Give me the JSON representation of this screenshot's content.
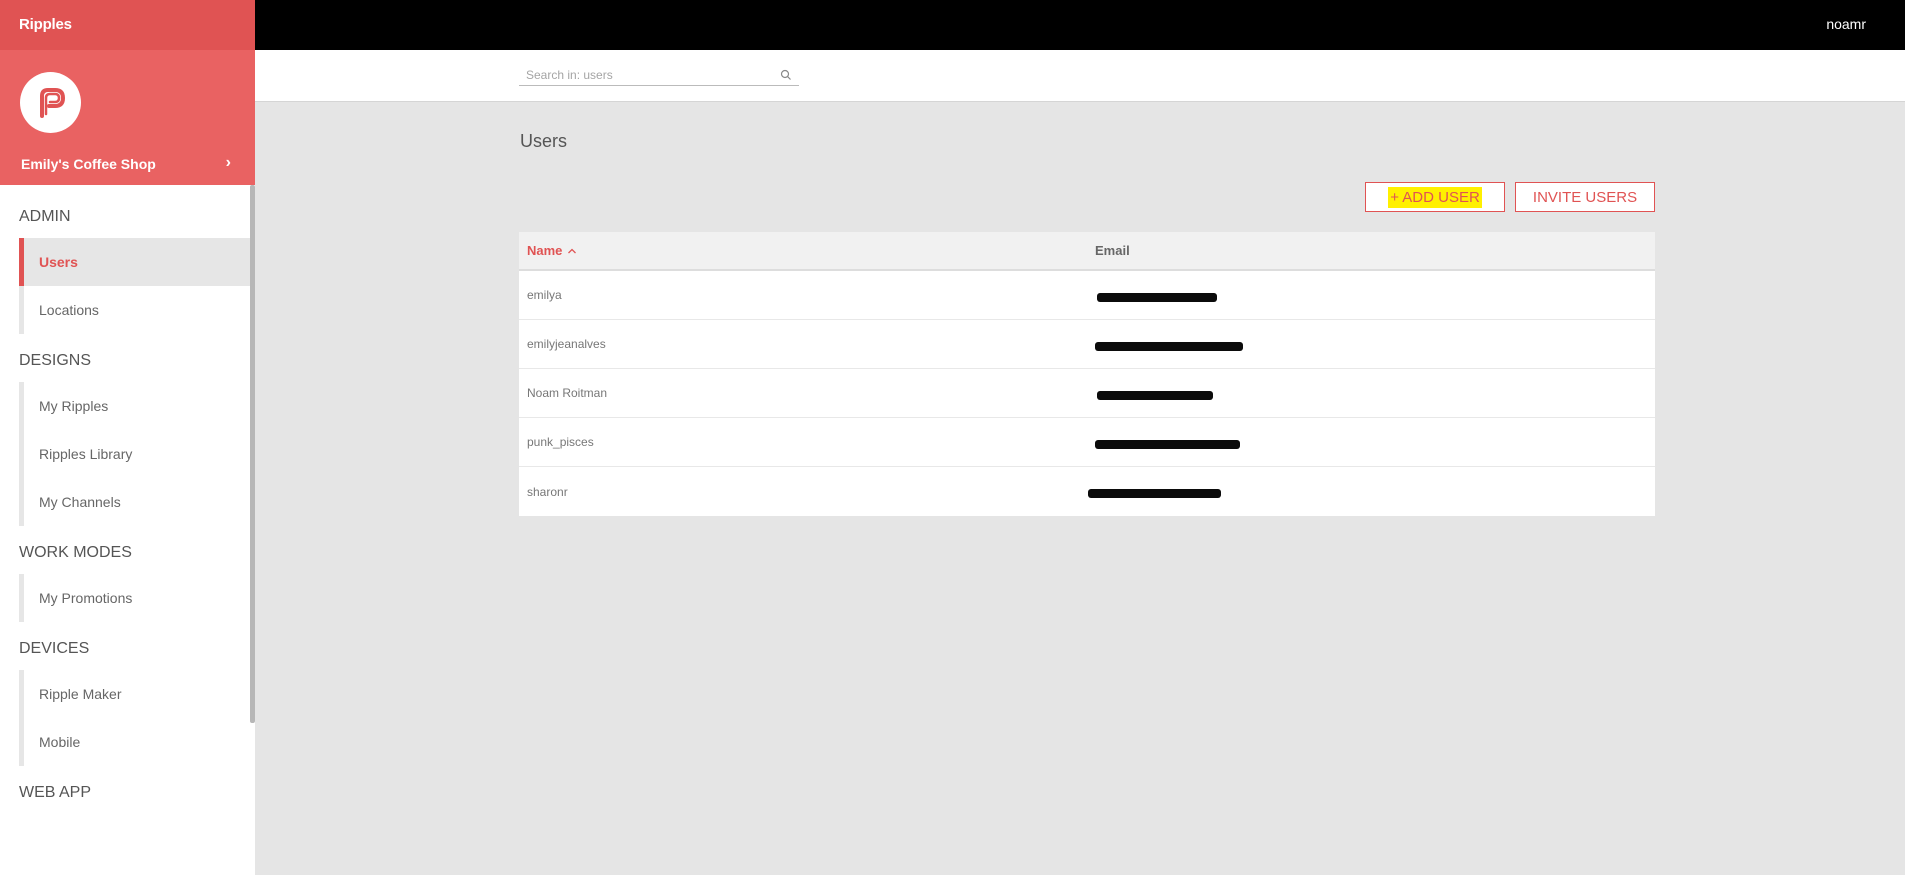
{
  "app": {
    "brand": "Ripples",
    "venue_name": "Emily's Coffee Shop",
    "user": "noamr"
  },
  "colors": {
    "accent": "#e05353",
    "venue_bg": "#e96262",
    "highlight": "#fff000"
  },
  "search": {
    "placeholder": "Search in: users",
    "value": ""
  },
  "sidebar": {
    "sections": [
      {
        "title": "ADMIN",
        "items": [
          {
            "label": "Users",
            "active": true
          },
          {
            "label": "Locations"
          }
        ]
      },
      {
        "title": "DESIGNS",
        "items": [
          {
            "label": "My Ripples"
          },
          {
            "label": "Ripples Library"
          },
          {
            "label": "My Channels"
          }
        ]
      },
      {
        "title": "WORK MODES",
        "items": [
          {
            "label": "My Promotions"
          }
        ]
      },
      {
        "title": "DEVICES",
        "items": [
          {
            "label": "Ripple Maker"
          },
          {
            "label": "Mobile"
          }
        ]
      },
      {
        "title": "WEB APP",
        "items": []
      }
    ]
  },
  "main": {
    "title": "Users",
    "add_user_label": "+ ADD USER",
    "invite_label": "INVITE USERS",
    "table": {
      "columns": [
        "Name",
        "Email"
      ],
      "sort_indicator": "ascending",
      "rows": [
        {
          "name": "emilya",
          "email_redacted": true
        },
        {
          "name": "emilyjeanalves",
          "email_redacted": true
        },
        {
          "name": "Noam Roitman",
          "email_redacted": true
        },
        {
          "name": "punk_pisces",
          "email_redacted": true
        },
        {
          "name": "sharonr",
          "email_redacted": true
        }
      ]
    }
  }
}
